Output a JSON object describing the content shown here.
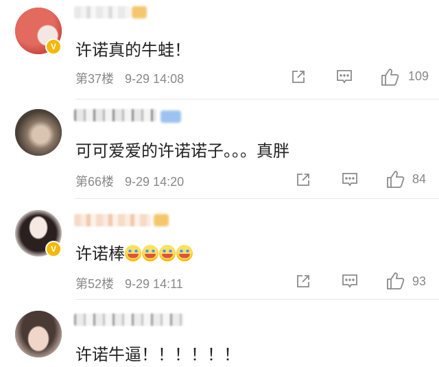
{
  "colors": {
    "badge": "#f5b800",
    "meta_text": "#888888",
    "comment_text": "#222222"
  },
  "comments": [
    {
      "text": "许诺真的牛蛙！",
      "floor": "第37楼",
      "time": "9-29 14:08",
      "likes": "109",
      "verified": true
    },
    {
      "text": "可可爱爱的许诺诺子。。。真胖",
      "floor": "第66楼",
      "time": "9-29 14:20",
      "likes": "84",
      "verified": false
    },
    {
      "text": "许诺棒",
      "emoji_count": 4,
      "floor": "第52楼",
      "time": "9-29 14:11",
      "likes": "93",
      "verified": true
    },
    {
      "text": "许诺牛逼！！！！！！",
      "verified": false
    }
  ],
  "icons": {
    "share": "share-icon",
    "reply": "reply-icon",
    "like": "thumbs-up-icon",
    "badge": "verified-badge-icon"
  }
}
